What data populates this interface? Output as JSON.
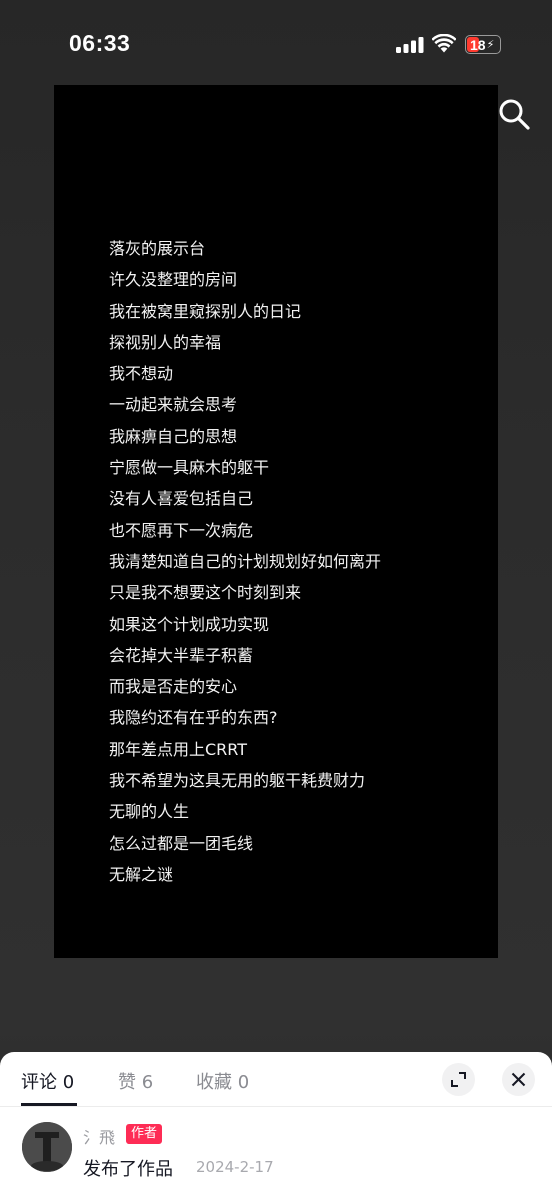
{
  "status_bar": {
    "time": "06:33",
    "battery": "18",
    "battery_color": "#ff3b30"
  },
  "poem": {
    "lines": [
      "落灰的展示台",
      "许久没整理的房间",
      "我在被窝里窥探别人的日记",
      "探视别人的幸福",
      "我不想动",
      "一动起来就会思考",
      "我麻痹自己的思想",
      "宁愿做一具麻木的躯干",
      "没有人喜爱包括自己",
      "也不愿再下一次病危",
      "我清楚知道自己的计划规划好如何离开",
      "只是我不想要这个时刻到来",
      "如果这个计划成功实现",
      "会花掉大半辈子积蓄",
      "而我是否走的安心",
      "我隐约还有在乎的东西?",
      "那年差点用上CRRT",
      "我不希望为这具无用的躯干耗费财力",
      "无聊的人生",
      "怎么过都是一团毛线",
      "无解之谜"
    ]
  },
  "sheet": {
    "tabs": [
      {
        "label": "评论 0"
      },
      {
        "label": "赞 6"
      },
      {
        "label": "收藏 0"
      }
    ],
    "author": {
      "name": "氵飛",
      "badge": "作者",
      "action": "发布了作品",
      "date": "2024-2-17"
    },
    "accent_color": "#fe2c55"
  }
}
